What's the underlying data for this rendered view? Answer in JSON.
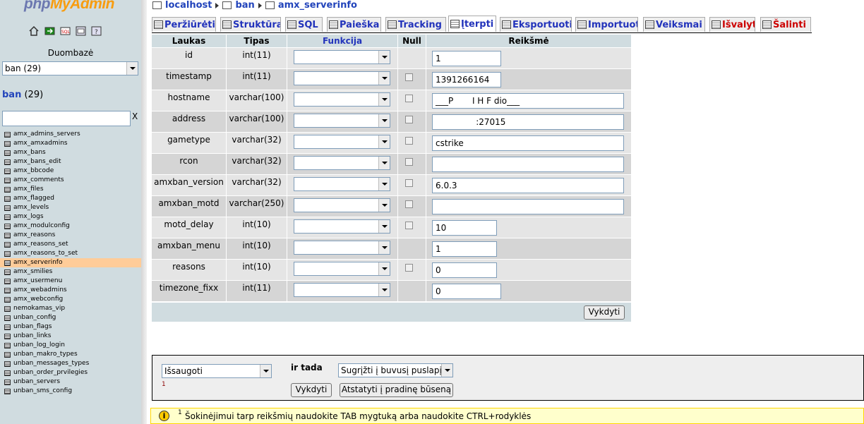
{
  "logo": {
    "part1": "php",
    "part2": "MyAdmin"
  },
  "nav_icons": [
    "home-icon",
    "exit-icon",
    "sql-icon",
    "query-window-icon",
    "docs-icon"
  ],
  "left": {
    "db_label": "Duombazė",
    "db_select_value": "ban (29)",
    "db_name": "ban",
    "db_count": "(29)",
    "filter_clear": "X",
    "tables": [
      "amx_admins_servers",
      "amx_amxadmins",
      "amx_bans",
      "amx_bans_edit",
      "amx_bbcode",
      "amx_comments",
      "amx_files",
      "amx_flagged",
      "amx_levels",
      "amx_logs",
      "amx_modulconfig",
      "amx_reasons",
      "amx_reasons_set",
      "amx_reasons_to_set",
      "amx_serverinfo",
      "amx_smilies",
      "amx_usermenu",
      "amx_webadmins",
      "amx_webconfig",
      "nemokamas_vip",
      "unban_config",
      "unban_flags",
      "unban_links",
      "unban_log_login",
      "unban_makro_types",
      "unban_messages_types",
      "unban_order_prvilegies",
      "unban_servers",
      "unban_sms_config"
    ],
    "active_table": "amx_serverinfo"
  },
  "breadcrumb": {
    "server": "localhost",
    "db": "ban",
    "table": "amx_serverinfo"
  },
  "tabs": [
    {
      "label": "Peržiūrėti",
      "icon": "browse-icon"
    },
    {
      "label": "Struktūra",
      "icon": "structure-icon"
    },
    {
      "label": "SQL",
      "icon": "sql-icon"
    },
    {
      "label": "Paieška",
      "icon": "search-icon"
    },
    {
      "label": "Tracking",
      "icon": "tracking-icon"
    },
    {
      "label": "Įterpti",
      "icon": "insert-icon"
    },
    {
      "label": "Eksportuoti",
      "icon": "export-icon"
    },
    {
      "label": "Importuoti",
      "icon": "import-icon"
    },
    {
      "label": "Veiksmai",
      "icon": "operations-icon"
    },
    {
      "label": "Išvalyti",
      "icon": "empty-icon"
    },
    {
      "label": "Šalinti",
      "icon": "drop-icon"
    }
  ],
  "table_headers": {
    "field": "Laukas",
    "type": "Tipas",
    "function": "Funkcija",
    "null": "Null",
    "value": "Reikšmė"
  },
  "rows": [
    {
      "field": "id",
      "type": "int(11)",
      "value": "1",
      "has_null": false
    },
    {
      "field": "timestamp",
      "type": "int(11)",
      "value": "1391266164",
      "has_null": true
    },
    {
      "field": "hostname",
      "type": "varchar(100)",
      "value": "___P       I H F  dio___",
      "has_null": true
    },
    {
      "field": "address",
      "type": "varchar(100)",
      "value": "               :27015",
      "has_null": true
    },
    {
      "field": "gametype",
      "type": "varchar(32)",
      "value": "cstrike",
      "has_null": true
    },
    {
      "field": "rcon",
      "type": "varchar(32)",
      "value": "",
      "has_null": true
    },
    {
      "field": "amxban_version",
      "type": "varchar(32)",
      "value": "6.0.3",
      "has_null": true
    },
    {
      "field": "amxban_motd",
      "type": "varchar(250)",
      "value": "",
      "has_null": true
    },
    {
      "field": "motd_delay",
      "type": "int(10)",
      "value": "10",
      "has_null": true
    },
    {
      "field": "amxban_menu",
      "type": "int(10)",
      "value": "1",
      "has_null": false
    },
    {
      "field": "reasons",
      "type": "int(10)",
      "value": "0",
      "has_null": true
    },
    {
      "field": "timezone_fixx",
      "type": "int(11)",
      "value": "0",
      "has_null": false
    }
  ],
  "submit_label": "Vykdyti",
  "bottom": {
    "save_select": "Išsaugoti",
    "footnote_mark": "1",
    "then_label": "ir tada",
    "then_select": "Sugrįžti į buvusį puslapį",
    "go_label": "Vykdyti",
    "reset_label": "Atstatyti į pradinę būseną"
  },
  "hint": {
    "mark": "1",
    "text": "Šokinėjimui tarp reikšmių naudokite TAB mygtuką arba naudokite CTRL+rodyklės"
  }
}
